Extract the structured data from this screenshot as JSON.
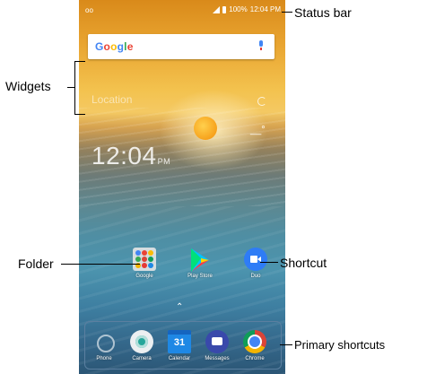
{
  "status_bar": {
    "left_icon": "voicemail-icon",
    "battery": "100%",
    "time": "12:04 PM"
  },
  "search_widget": {
    "logo": "Google",
    "mic_icon": "mic-icon"
  },
  "weather_widget": {
    "location": "Location",
    "refresh_icon": "refresh-icon",
    "temp": "__°"
  },
  "clock_widget": {
    "time": "12:04",
    "ampm": "PM"
  },
  "home_apps": [
    {
      "label": "Google",
      "icon": "folder-icon"
    },
    {
      "label": "Play Store",
      "icon": "play-store-icon"
    },
    {
      "label": "Duo",
      "icon": "duo-icon"
    }
  ],
  "dock_apps": [
    {
      "label": "Phone",
      "icon": "phone-icon"
    },
    {
      "label": "Camera",
      "icon": "camera-icon"
    },
    {
      "label": "Calendar",
      "icon": "calendar-icon",
      "badge": "31"
    },
    {
      "label": "Messages",
      "icon": "messages-icon"
    },
    {
      "label": "Chrome",
      "icon": "chrome-icon"
    }
  ],
  "callouts": {
    "status_bar": "Status bar",
    "widgets": "Widgets",
    "folder": "Folder",
    "shortcut": "Shortcut",
    "primary_shortcuts": "Primary shortcuts"
  }
}
